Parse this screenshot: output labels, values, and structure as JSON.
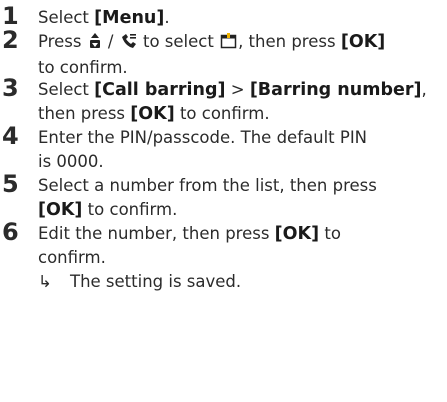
{
  "steps": [
    {
      "number": "1",
      "before": "Select ",
      "kw1": "[Menu]",
      "after": "."
    },
    {
      "number": "2",
      "t1": "Press ",
      "t2": " / ",
      "t3": " to select ",
      "t4": ", then press ",
      "kw1": "[OK]",
      "t5": "to confirm.",
      "icons": [
        "up-down-nav-icon",
        "redial-phonebook-icon",
        "settings-menu-icon"
      ]
    },
    {
      "number": "3",
      "t1": "Select ",
      "kw1": "[Call barring]",
      "t2": " > ",
      "kw2": "[Barring number]",
      "t3": ",",
      "t4": "then press ",
      "kw3": "[OK]",
      "t5": " to confirm."
    },
    {
      "number": "4",
      "line1": "Enter the PIN/passcode. The default PIN",
      "line2": "is 0000."
    },
    {
      "number": "5",
      "line1": "Select a number from the list, then press",
      "kw1": "[OK]",
      "t2": " to confirm."
    },
    {
      "number": "6",
      "t1": "Edit the number, then press ",
      "kw1": "[OK]",
      "t2": " to",
      "line2": "confirm."
    }
  ],
  "result": {
    "arrow": "↳",
    "text": "The setting is saved."
  }
}
